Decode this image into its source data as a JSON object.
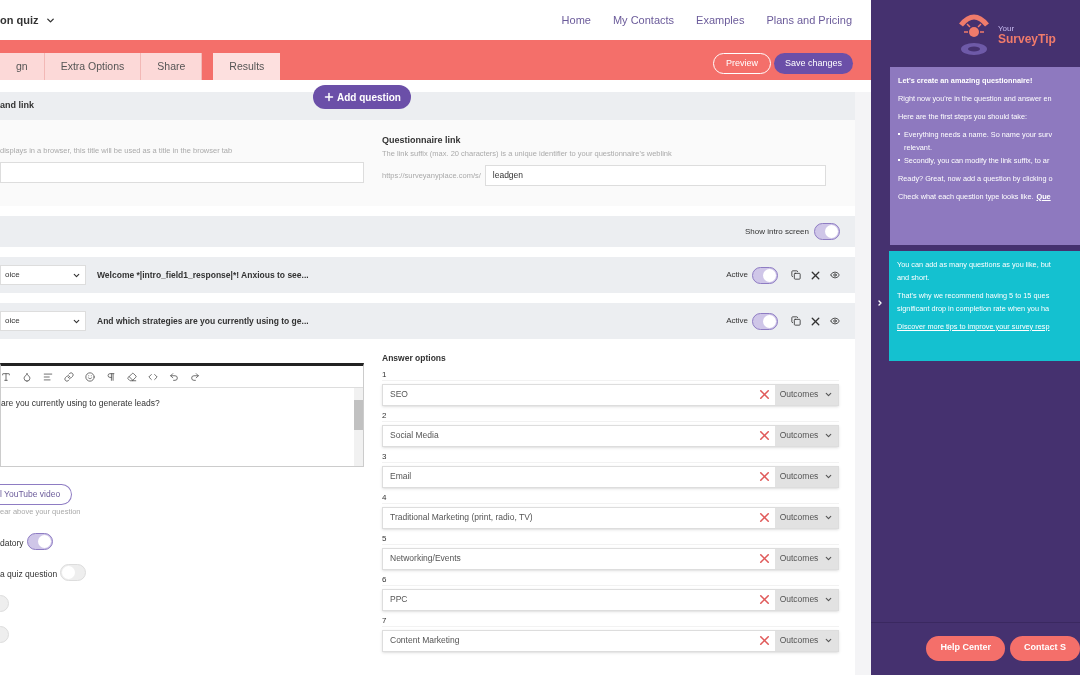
{
  "header": {
    "title": "on quiz",
    "nav": [
      "Home",
      "My Contacts",
      "Examples",
      "Plans and Pricing"
    ]
  },
  "tabs": [
    {
      "label": "gn",
      "selected": false
    },
    {
      "label": "Extra Options",
      "selected": false
    },
    {
      "label": "Share",
      "selected": false
    },
    {
      "label": "Results",
      "selected": true
    }
  ],
  "actions": {
    "preview": "Preview",
    "save": "Save changes"
  },
  "add_question": "Add question",
  "title_section": {
    "heading": "and link",
    "title_hint": "displays in a browser, this title will be used as a title in the browser tab",
    "link_label": "Questionnaire link",
    "link_hint": "The link suffix (max. 20 characters) is a unique identifier to your questionnaire's weblink",
    "link_prefix": "https://surveyanyplace.com/s/",
    "link_value": "leadgen"
  },
  "intro": {
    "label": "Show intro screen",
    "on": true
  },
  "questions": [
    {
      "type": "oice",
      "text": "Welcome *|intro_field1_response|*! Anxious to see...",
      "active_label": "Active",
      "active": true
    },
    {
      "type": "oice",
      "text": "And which strategies are you currently using to ge...",
      "active_label": "Active",
      "active": true
    }
  ],
  "editor": {
    "body": "are you currently using to generate leads?",
    "video_button": "l YouTube video",
    "video_hint": "ear above your question",
    "toggles": [
      {
        "label": "datory",
        "on": true
      },
      {
        "label": "a quiz question",
        "on": false
      },
      {
        "on": false
      },
      {
        "on": false
      }
    ]
  },
  "answers": {
    "heading": "Answer options",
    "items": [
      {
        "number": "1",
        "value": "SEO",
        "outcomes": "Outcomes"
      },
      {
        "number": "2",
        "value": "Social Media",
        "outcomes": "Outcomes"
      },
      {
        "number": "3",
        "value": "Email",
        "outcomes": "Outcomes"
      },
      {
        "number": "4",
        "value": "Traditional Marketing (print, radio, TV)",
        "outcomes": "Outcomes"
      },
      {
        "number": "5",
        "value": "Networking/Events",
        "outcomes": "Outcomes"
      },
      {
        "number": "6",
        "value": "PPC",
        "outcomes": "Outcomes"
      },
      {
        "number": "7",
        "value": "Content Marketing",
        "outcomes": "Outcomes"
      }
    ]
  },
  "tips": {
    "logo_small": "Your",
    "logo_big": "SurveyTip",
    "card1": {
      "title": "Let's create an amazing questionnaire!",
      "lines": [
        "Right now you're in the question and answer en",
        "Here are the first steps you should take:"
      ],
      "bullets": [
        [
          "Everything needs a name. So name your surv",
          "relevant."
        ],
        [
          "Secondly, you can modify the link suffix, to ar"
        ]
      ],
      "ready": "Ready? Great, now add a question by clicking o",
      "check": "Check what each question type looks like.",
      "check_link": "Que"
    },
    "card2": {
      "p1": [
        "You can add as many questions as you like, but",
        "and short."
      ],
      "p2": [
        "That's why we recommend having 5 to 15 ques",
        "significant drop in completion rate when you ha"
      ],
      "link": "Discover more tips to improve your survey resp"
    },
    "buttons": [
      "Help Center",
      "Contact S"
    ]
  }
}
